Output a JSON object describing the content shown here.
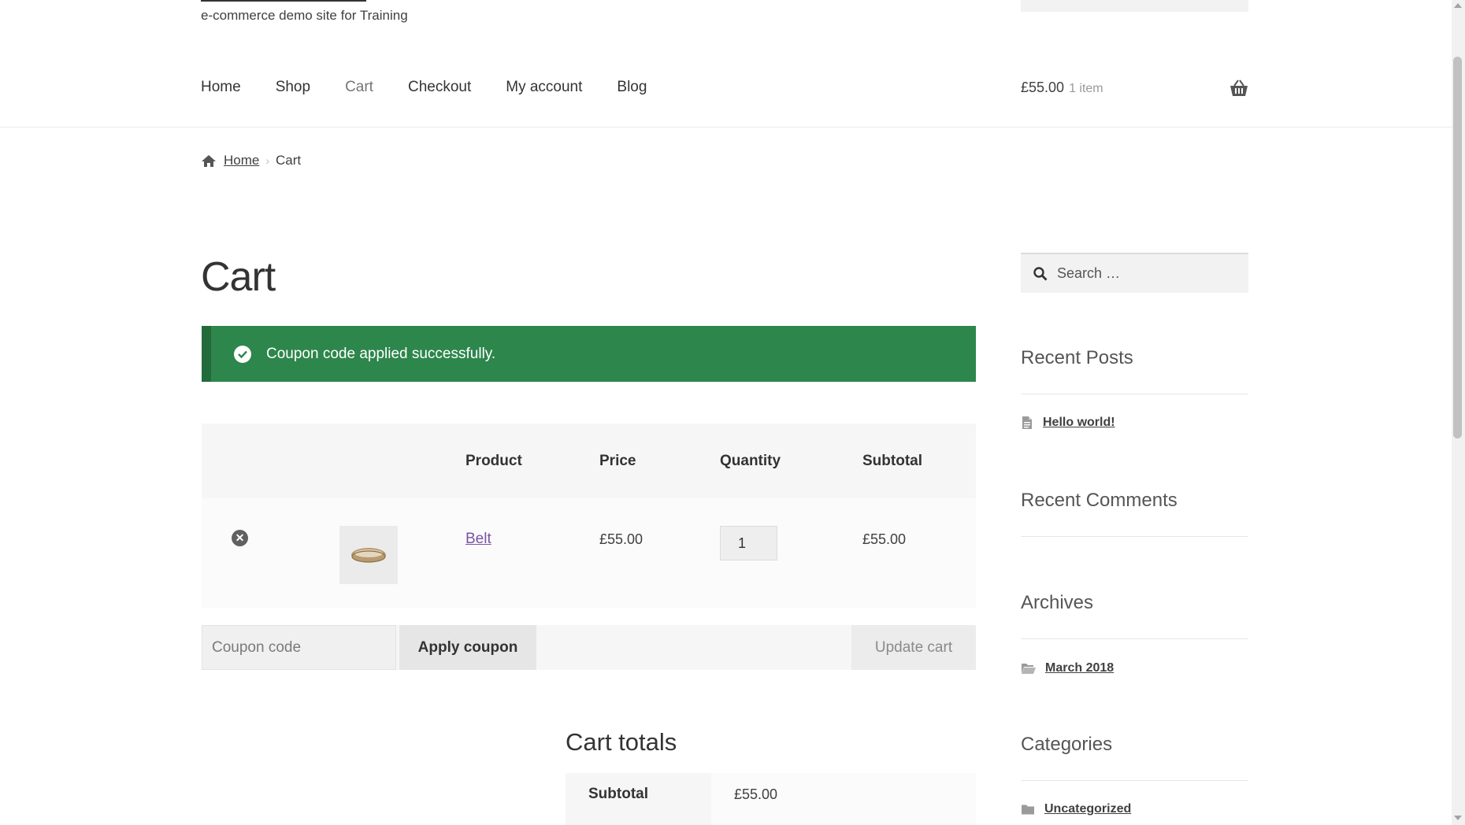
{
  "header": {
    "tagline": "e-commerce demo site for Training",
    "nav": [
      {
        "label": "Home"
      },
      {
        "label": "Shop"
      },
      {
        "label": "Cart",
        "current": true
      },
      {
        "label": "Checkout"
      },
      {
        "label": "My account"
      },
      {
        "label": "Blog"
      }
    ],
    "cart_amount": "£55.00",
    "cart_count": "1 item",
    "basket_icon": "basket-icon"
  },
  "breadcrumb": {
    "home_icon": "home-icon",
    "home": "Home",
    "current": "Cart"
  },
  "page_title": "Cart",
  "notice": {
    "message": "Coupon code applied successfully.",
    "icon": "check-circle-icon",
    "color": "#2d864b"
  },
  "cart_table": {
    "headers": {
      "product": "Product",
      "price": "Price",
      "quantity": "Quantity",
      "subtotal": "Subtotal"
    },
    "items": [
      {
        "name": "Belt",
        "price": "£55.00",
        "quantity": "1",
        "subtotal": "£55.00",
        "remove_icon": "remove-icon",
        "thumbnail": "belt-thumbnail"
      }
    ],
    "coupon_placeholder": "Coupon code",
    "apply_coupon": "Apply coupon",
    "update_cart": "Update cart"
  },
  "cart_totals": {
    "title": "Cart totals",
    "subtotal_label": "Subtotal",
    "subtotal_value": "£55.00"
  },
  "sidebar": {
    "search_placeholder": "Search …",
    "recent_posts": {
      "title": "Recent Posts",
      "items": [
        "Hello world!"
      ]
    },
    "recent_comments": {
      "title": "Recent Comments"
    },
    "archives": {
      "title": "Archives",
      "items": [
        "March 2018"
      ]
    },
    "categories": {
      "title": "Categories",
      "items": [
        "Uncategorized"
      ]
    }
  },
  "colors": {
    "link_purple": "#7a53a3",
    "success_green": "#2d864b"
  }
}
